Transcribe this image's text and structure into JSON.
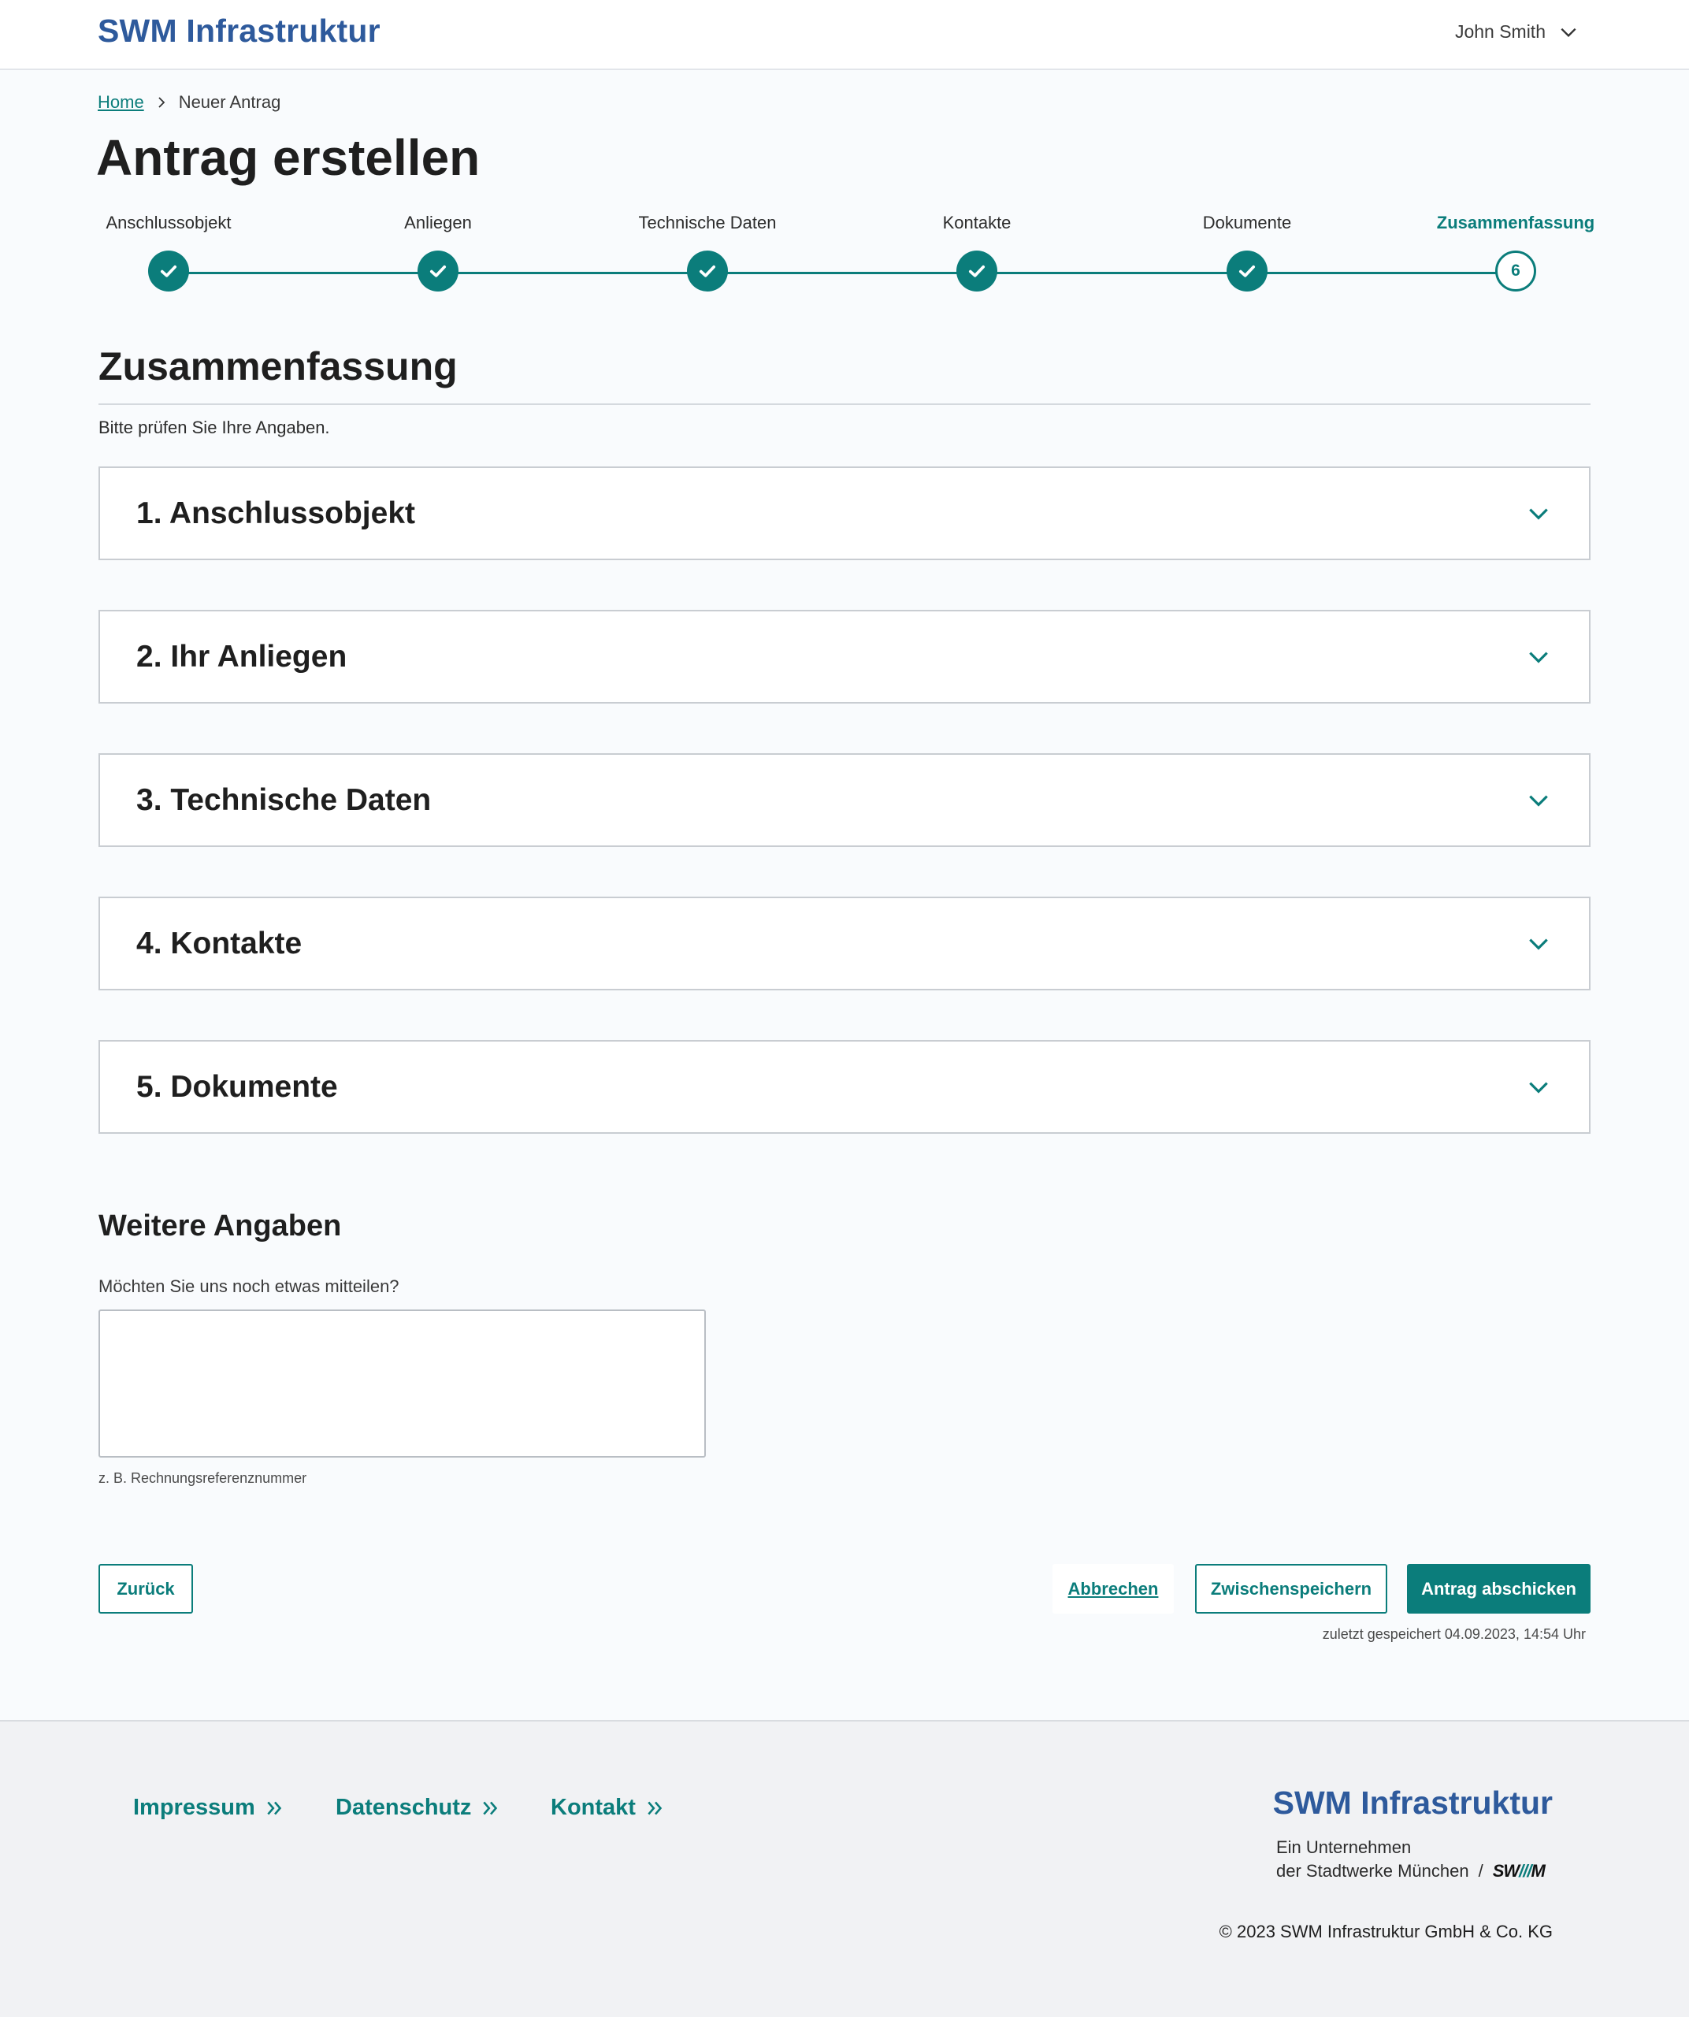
{
  "header": {
    "logo": "SWM Infrastruktur",
    "user_name": "John Smith"
  },
  "breadcrumb": {
    "home": "Home",
    "current": "Neuer Antrag"
  },
  "page_title": "Antrag erstellen",
  "stepper": {
    "steps": [
      {
        "label": "Anschlussobjekt",
        "state": "done"
      },
      {
        "label": "Anliegen",
        "state": "done"
      },
      {
        "label": "Technische Daten",
        "state": "done"
      },
      {
        "label": "Kontakte",
        "state": "done"
      },
      {
        "label": "Dokumente",
        "state": "done"
      },
      {
        "label": "Zusammenfassung",
        "state": "current",
        "number": "6"
      }
    ]
  },
  "summary": {
    "title": "Zusammenfassung",
    "subtitle": "Bitte prüfen Sie Ihre Angaben.",
    "sections": [
      {
        "title": "1. Anschlussobjekt"
      },
      {
        "title": "2. Ihr Anliegen"
      },
      {
        "title": "3. Technische Daten"
      },
      {
        "title": "4. Kontakte"
      },
      {
        "title": "5. Dokumente"
      }
    ]
  },
  "further": {
    "title": "Weitere Angaben",
    "question": "Möchten Sie uns noch etwas mitteilen?",
    "value": "",
    "hint": "z. B. Rechnungsreferenznummer"
  },
  "actions": {
    "back": "Zurück",
    "cancel": "Abbrechen",
    "save": "Zwischenspeichern",
    "submit": "Antrag abschicken",
    "saved_note": "zuletzt gespeichert 04.09.2023, 14:54 Uhr"
  },
  "footer": {
    "links": [
      "Impressum",
      "Datenschutz",
      "Kontakt"
    ],
    "logo": "SWM Infrastruktur",
    "company_line1": "Ein Unternehmen",
    "company_line2": "der Stadtwerke München",
    "separator": "/",
    "swm_mark_left": "SW",
    "swm_mark_slashes": "///",
    "swm_mark_right": "M",
    "copyright": "© 2023 SWM Infrastruktur GmbH & Co. KG"
  },
  "colors": {
    "accent": "#0b7d7b",
    "brand": "#2e5a9c",
    "background": "#f9fbfd",
    "footer_bg": "#f1f2f4"
  },
  "icons": {
    "user_menu": "chevron-down-icon",
    "breadcrumb_separator": "chevron-right-icon",
    "step_done": "check-icon",
    "accordion": "chevron-down-icon",
    "footer_link": "double-chevron-right-icon"
  }
}
